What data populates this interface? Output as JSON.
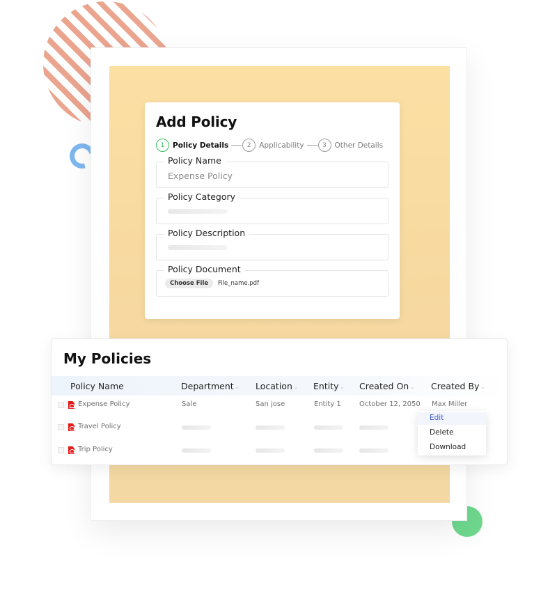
{
  "add_policy": {
    "title": "Add Policy",
    "steps": [
      {
        "num": "1",
        "label": "Policy Details",
        "active": true
      },
      {
        "num": "2",
        "label": "Applicability",
        "active": false
      },
      {
        "num": "3",
        "label": "Other Details",
        "active": false
      }
    ],
    "fields": {
      "policy_name": {
        "label": "Policy Name",
        "placeholder": "Expense Policy"
      },
      "policy_category": {
        "label": "Policy Category"
      },
      "policy_description": {
        "label": "Policy Description"
      },
      "policy_document": {
        "label": "Policy Document",
        "button": "Choose File",
        "file_name": "File_name.pdf"
      }
    }
  },
  "my_policies": {
    "title": "My Policies",
    "columns": [
      "Policy Name",
      "Department",
      "Location",
      "Entity",
      "Created On",
      "Created By"
    ],
    "rows": [
      {
        "name": "Expense Policy",
        "department": "Sale",
        "location": "San jose",
        "entity": "Entity 1",
        "created_on": "October 12, 2050",
        "created_by": "Max Miller"
      },
      {
        "name": "Travel Policy",
        "department": "",
        "location": "",
        "entity": "",
        "created_on": "",
        "created_by": ""
      },
      {
        "name": "Trip Policy",
        "department": "",
        "location": "",
        "entity": "",
        "created_on": "",
        "created_by": ""
      }
    ],
    "context_menu": [
      "Edit",
      "Delete",
      "Download"
    ]
  },
  "colors": {
    "step_active": "#31c05a",
    "menu_active": "#3d5ad6",
    "pdf_icon": "#e51b1b",
    "backdrop": "#fbdfa3"
  }
}
